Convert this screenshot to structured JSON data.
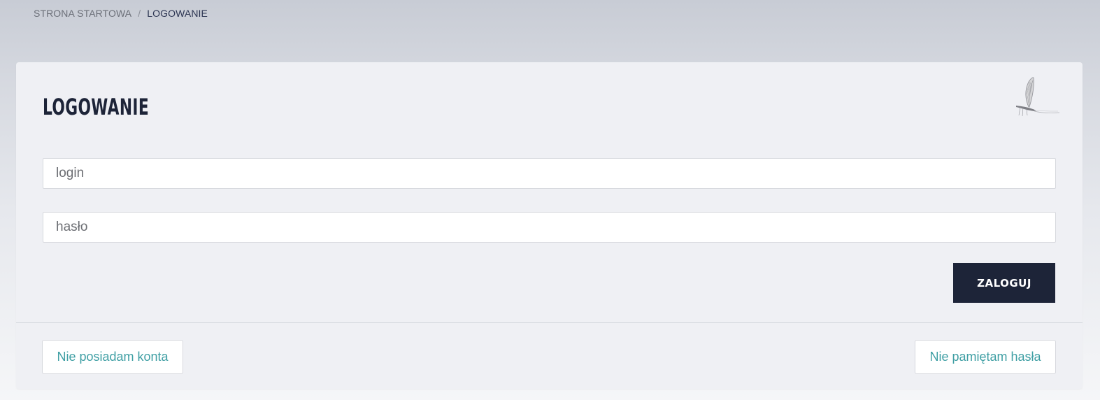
{
  "breadcrumb": {
    "home": "STRONA STARTOWA",
    "separator": "/",
    "current": "LOGOWANIE"
  },
  "login_card": {
    "title": "LOGOWANIE",
    "logo_icon": "mayfly-logo-icon",
    "login_placeholder": "login",
    "password_placeholder": "hasło",
    "submit_label": "ZALOGUJ",
    "no_account_label": "Nie posiadam konta",
    "forgot_password_label": "Nie pamiętam hasła"
  },
  "colors": {
    "primary_dark": "#1d2438",
    "link_teal": "#3f9fa4",
    "card_bg": "#eff0f4"
  }
}
